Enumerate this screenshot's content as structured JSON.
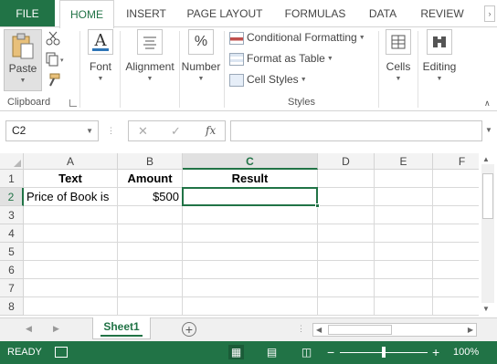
{
  "tabs": {
    "file": "FILE",
    "home": "HOME",
    "insert": "INSERT",
    "page_layout": "PAGE LAYOUT",
    "formulas": "FORMULAS",
    "data": "DATA",
    "review": "REVIEW"
  },
  "ribbon": {
    "paste": "Paste",
    "clipboard": "Clipboard",
    "font": "Font",
    "alignment": "Alignment",
    "number": "Number",
    "conditional_formatting": "Conditional Formatting",
    "format_as_table": "Format as Table",
    "cell_styles": "Cell Styles",
    "styles": "Styles",
    "cells": "Cells",
    "editing": "Editing",
    "font_glyph": "A",
    "number_glyph": "%"
  },
  "formula_bar": {
    "name_box": "C2",
    "cancel": "✕",
    "enter": "✓",
    "fx": "fx",
    "content": ""
  },
  "grid": {
    "columns": [
      "A",
      "B",
      "C",
      "D",
      "E",
      "F"
    ],
    "selected_column": "C",
    "rows": [
      "1",
      "2",
      "3",
      "4",
      "5",
      "6",
      "7",
      "8"
    ],
    "selected_row": "2",
    "cells": {
      "A1": "Text",
      "B1": "Amount",
      "C1": "Result",
      "A2": "Price of Book is",
      "B2": "$500",
      "C2": ""
    }
  },
  "sheets": {
    "active": "Sheet1",
    "add": "+"
  },
  "status": {
    "ready": "READY",
    "zoom_minus": "−",
    "zoom_plus": "+",
    "zoom_level": "100%",
    "zoom_fraction": 0.5
  },
  "colors": {
    "accent": "#217346",
    "header_bg": "#f3f3f3",
    "gridline": "#d9d9d9"
  }
}
